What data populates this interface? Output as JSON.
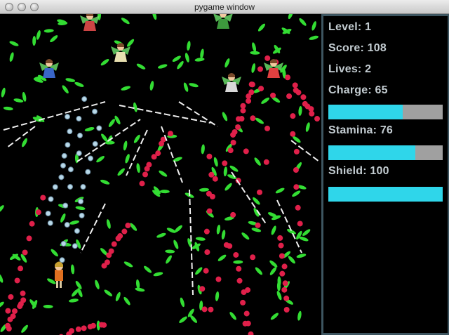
{
  "window": {
    "title": "pygame window"
  },
  "hud": {
    "level_label": "Level: 1",
    "score_label": "Score: 108",
    "lives_label": "Lives: 2",
    "charge_label": "Charge: 65",
    "charge_level": 0.65,
    "stamina_label": "Stamina: 76",
    "stamina_level": 0.76,
    "shield_label": "Shield: 100",
    "shield_level": 1.0
  },
  "colors": {
    "hud_text": "#c3ccd1",
    "bar_fill": "#2fd6ea",
    "bar_track": "#a0a0a0",
    "hud_border": "#3d5560",
    "leaf_bullet": "#33dd33",
    "red_bullet": "#e0204a",
    "orb_bullet": "#b8d8e8",
    "white_beam": "#f0f0f0"
  },
  "sprites": {
    "player": "player-sprite",
    "enemies": [
      "enemy-fairy-sprite",
      "enemy-fairy-sprite",
      "enemy-fairy-sprite",
      "enemy-fairy-sprite",
      "enemy-fairy-sprite",
      "enemy-fairy-sprite"
    ]
  }
}
